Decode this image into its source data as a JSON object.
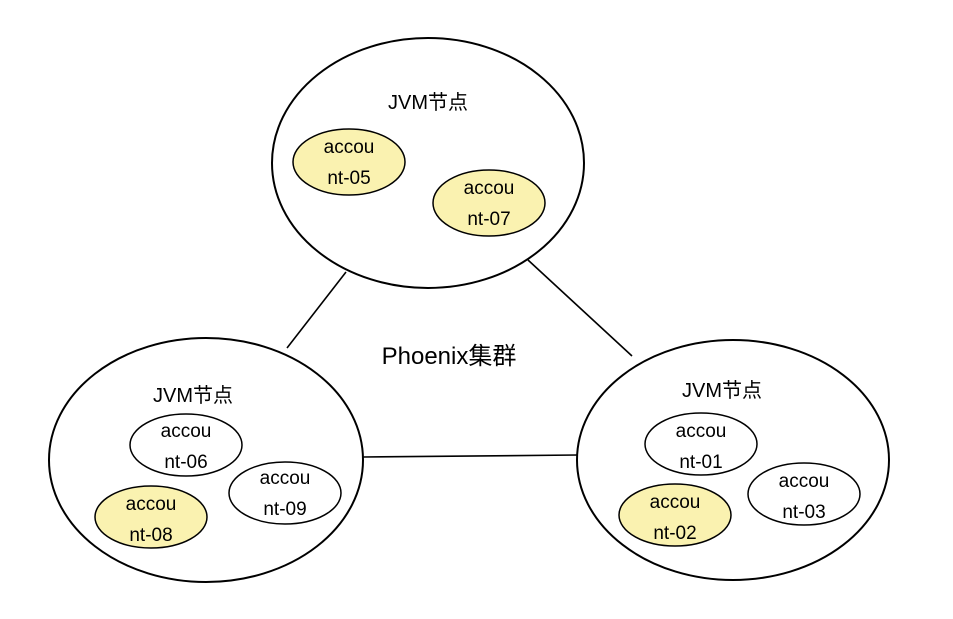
{
  "cluster": {
    "label": "Phoenix集群"
  },
  "colors": {
    "highlight": "#FAF2B0",
    "plain": "#FFFFFF",
    "stroke": "#000000"
  },
  "nodes": [
    {
      "title": "JVM节点",
      "accounts": [
        {
          "line1": "accou",
          "line2": "nt-05",
          "highlighted": true
        },
        {
          "line1": "accou",
          "line2": "nt-07",
          "highlighted": true
        }
      ]
    },
    {
      "title": "JVM节点",
      "accounts": [
        {
          "line1": "accou",
          "line2": "nt-06",
          "highlighted": false
        },
        {
          "line1": "accou",
          "line2": "nt-09",
          "highlighted": false
        },
        {
          "line1": "accou",
          "line2": "nt-08",
          "highlighted": true
        }
      ]
    },
    {
      "title": "JVM节点",
      "accounts": [
        {
          "line1": "accou",
          "line2": "nt-01",
          "highlighted": false
        },
        {
          "line1": "accou",
          "line2": "nt-03",
          "highlighted": false
        },
        {
          "line1": "accou",
          "line2": "nt-02",
          "highlighted": true
        }
      ]
    }
  ]
}
